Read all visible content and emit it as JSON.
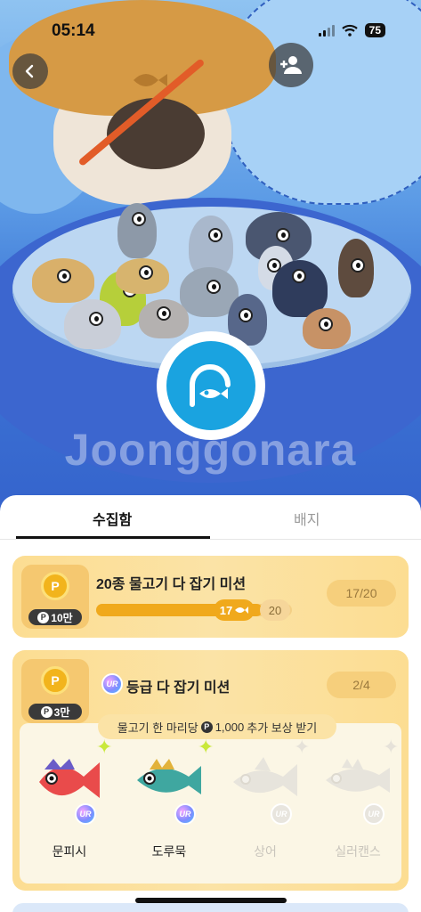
{
  "status_bar": {
    "time": "05:14",
    "battery": "75"
  },
  "header": {
    "back_icon": "chevron-left-icon",
    "add_friend_icon": "person-add-icon"
  },
  "hero": {
    "watermark": "Joonggonara",
    "logo_icon": "fishing-logo-icon"
  },
  "tabs": [
    {
      "label": "수집함",
      "active": true
    },
    {
      "label": "배지",
      "active": false
    }
  ],
  "missions": [
    {
      "title": "20종 물고기 다 잡기 미션",
      "reward": "10만",
      "count": "17/20",
      "progress_current": "17",
      "progress_total": "20",
      "progress_fraction": 0.85
    },
    {
      "title": "등급 다 잡기 미션",
      "grade_badge": "UR",
      "reward": "3만",
      "count": "2/4",
      "bonus_text_before": "물고기 한 마리당",
      "bonus_amount": "1,000",
      "bonus_text_after": "추가 보상 받기",
      "fishes": [
        {
          "name": "문피시",
          "owned": true,
          "badge": "UR"
        },
        {
          "name": "도루묵",
          "owned": true,
          "badge": "UR"
        },
        {
          "name": "상어",
          "owned": false,
          "badge": "UR"
        },
        {
          "name": "실러캔스",
          "owned": false,
          "badge": "UR"
        }
      ]
    }
  ],
  "currency_symbol": "P",
  "colors": {
    "accent": "#f0a91c",
    "card": "#fcdd92",
    "logo": "#1aa3e0",
    "board": "#3c66cf"
  }
}
